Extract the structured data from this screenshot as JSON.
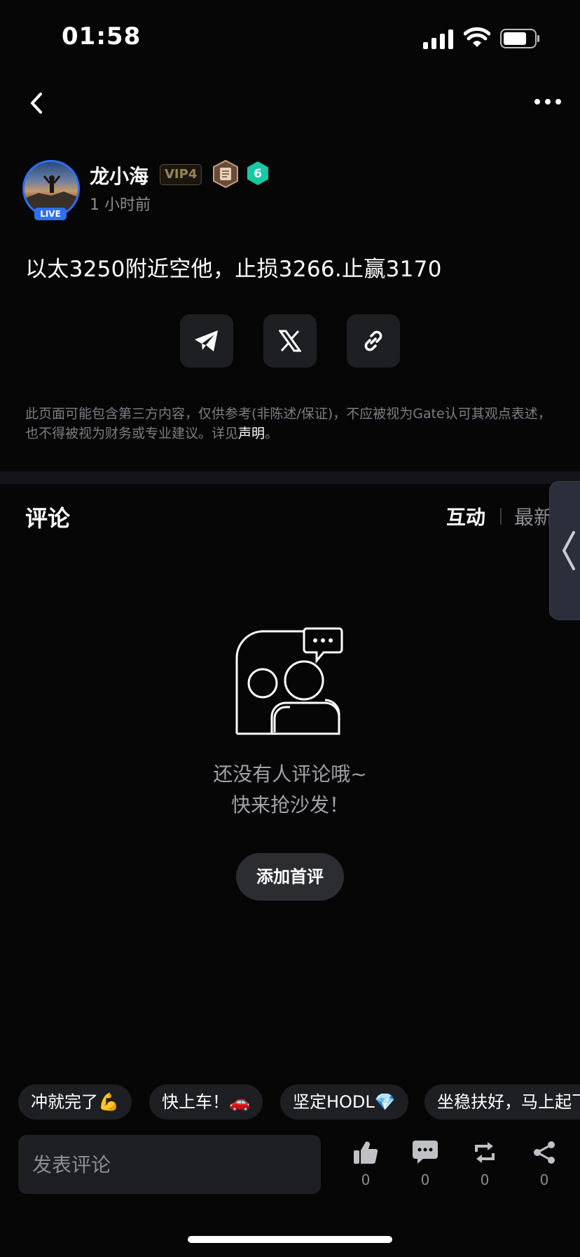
{
  "status_bar": {
    "time": "01:58"
  },
  "post": {
    "author": "龙小海",
    "vip": "VIP4",
    "level": "6",
    "live_badge": "LIVE",
    "time_ago": "1 小时前",
    "content": "以太3250附近空他，止损3266.止赢3170"
  },
  "share": [
    "telegram-icon",
    "x-icon",
    "link-icon"
  ],
  "disclaimer": {
    "text": "此页面可能包含第三方内容，仅供参考(非陈述/保证)，不应被视为Gate认可其观点表述，也不得被视为财务或专业建议。详见",
    "link": "声明",
    "end": "。"
  },
  "comments": {
    "title": "评论",
    "tab_active": "互动",
    "tab_inactive": "最新",
    "empty_line1": "还没有人评论哦~",
    "empty_line2": "快来抢沙发！",
    "add_first": "添加首评"
  },
  "quick_replies": [
    "冲就完了💪",
    "快上车！🚗",
    "坚定HODL💎",
    "坐稳扶好，马上起飞"
  ],
  "bottom_bar": {
    "input_placeholder": "发表评论",
    "like_count": "0",
    "comment_count": "0",
    "repost_count": "0",
    "share_count": "0"
  },
  "colors": {
    "background": "#060607",
    "accent_blue": "#2f6ff5",
    "level_badge": "#19c8a5",
    "vip_gold": "#9a8552"
  }
}
